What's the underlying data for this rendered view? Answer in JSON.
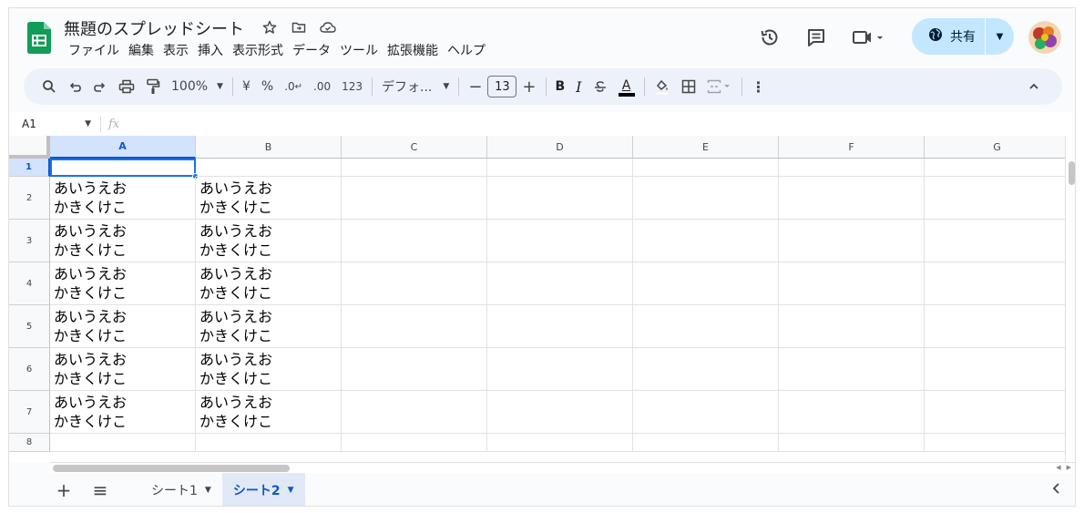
{
  "doc": {
    "title": "無題のスプレッドシート",
    "menu": [
      "ファイル",
      "編集",
      "表示",
      "挿入",
      "表示形式",
      "データ",
      "ツール",
      "拡張機能",
      "ヘルプ"
    ]
  },
  "header": {
    "share_label": "共有"
  },
  "toolbar": {
    "zoom": "100%",
    "currency": "¥",
    "percent": "%",
    "dec_decrease": ".0",
    "dec_increase": ".00",
    "number_format": "123",
    "font": "デフォ...",
    "font_size": "13",
    "bold": "B",
    "italic": "I",
    "text_color": "A"
  },
  "formula_bar": {
    "cell_ref": "A1",
    "fx": "fx",
    "value": ""
  },
  "grid": {
    "columns": [
      "A",
      "B",
      "C",
      "D",
      "E",
      "F",
      "G"
    ],
    "rows": [
      "1",
      "2",
      "3",
      "4",
      "5",
      "6",
      "7",
      "8"
    ],
    "selected_cell": "A1",
    "cells": {
      "A2": "あいうえお\nかきくけこ",
      "B2": "あいうえお\nかきくけこ",
      "A3": "あいうえお\nかきくけこ",
      "B3": "あいうえお\nかきくけこ",
      "A4": "あいうえお\nかきくけこ",
      "B4": "あいうえお\nかきくけこ",
      "A5": "あいうえお\nかきくけこ",
      "B5": "あいうえお\nかきくけこ",
      "A6": "あいうえお\nかきくけこ",
      "B6": "あいうえお\nかきくけこ",
      "A7": "あいうえお\nかきくけこ",
      "B7": "あいうえお\nかきくけこ"
    }
  },
  "sheets": {
    "tabs": [
      "シート1",
      "シート2"
    ],
    "active": "シート2"
  },
  "colors": {
    "accent": "#0b57d0",
    "share_bg": "#c2e7ff",
    "toolbar_bg": "#edf2fa",
    "selection": "#1a73e8",
    "sheets_green": "#0f9d58"
  },
  "icons": {
    "logo": "google-sheets-logo",
    "star": "star-icon",
    "move": "move-to-folder-icon",
    "cloud": "cloud-saved-icon",
    "history": "version-history-icon",
    "comments": "comments-icon",
    "meet": "video-call-icon",
    "globe": "globe-icon"
  }
}
